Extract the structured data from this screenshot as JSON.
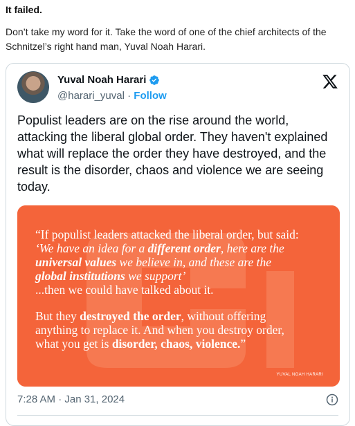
{
  "article": {
    "title": "It failed.",
    "paragraph": "Don’t take my word for it. Take the word of one of the chief architects of the Schnitzel’s right hand man, Yuval Noah Harari."
  },
  "tweet": {
    "author_name": "Yuval Noah Harari",
    "handle": "@harari_yuval",
    "separator": " · ",
    "follow_label": "Follow",
    "text": "Populist leaders are on the rise around the world, attacking the liberal global order. They haven't explained what will replace the order they have destroyed, and the result is the disorder, chaos and violence we are seeing today.",
    "timestamp": "7:28 AM · Jan 31, 2024",
    "media": {
      "background_color": "#f4643a",
      "lines": [
        {
          "parts": [
            {
              "t": "“If populist leaders attacked the liberal order, but said:"
            }
          ]
        },
        {
          "parts": [
            {
              "t": "‘We have an idea for a ",
              "s": "i"
            },
            {
              "t": "different order",
              "s": "bi"
            },
            {
              "t": ", here are the",
              "s": "i"
            }
          ]
        },
        {
          "parts": [
            {
              "t": "universal values",
              "s": "bi"
            },
            {
              "t": " we believe in, and these are the",
              "s": "i"
            }
          ]
        },
        {
          "parts": [
            {
              "t": "global institutions",
              "s": "bi"
            },
            {
              "t": " we support’",
              "s": "i"
            }
          ]
        },
        {
          "parts": [
            {
              "t": "...then we could have talked about it."
            }
          ]
        },
        {
          "gap": true
        },
        {
          "parts": [
            {
              "t": "But they "
            },
            {
              "t": "destroyed the order",
              "s": "b"
            },
            {
              "t": ", without offering"
            }
          ]
        },
        {
          "parts": [
            {
              "t": "anything to replace it. And when you destroy order,"
            }
          ]
        },
        {
          "parts": [
            {
              "t": "what you get is "
            },
            {
              "t": "disorder, chaos, violence.",
              "s": "b"
            },
            {
              "t": "”"
            }
          ]
        }
      ],
      "credit": "YUVAL NOAH HARARI"
    }
  },
  "colors": {
    "accent": "#1d9bf0",
    "text": "#0f1419",
    "muted": "#536471",
    "border": "#cfd9de"
  },
  "icons": [
    "verified-badge-icon",
    "x-logo-icon",
    "info-icon"
  ]
}
